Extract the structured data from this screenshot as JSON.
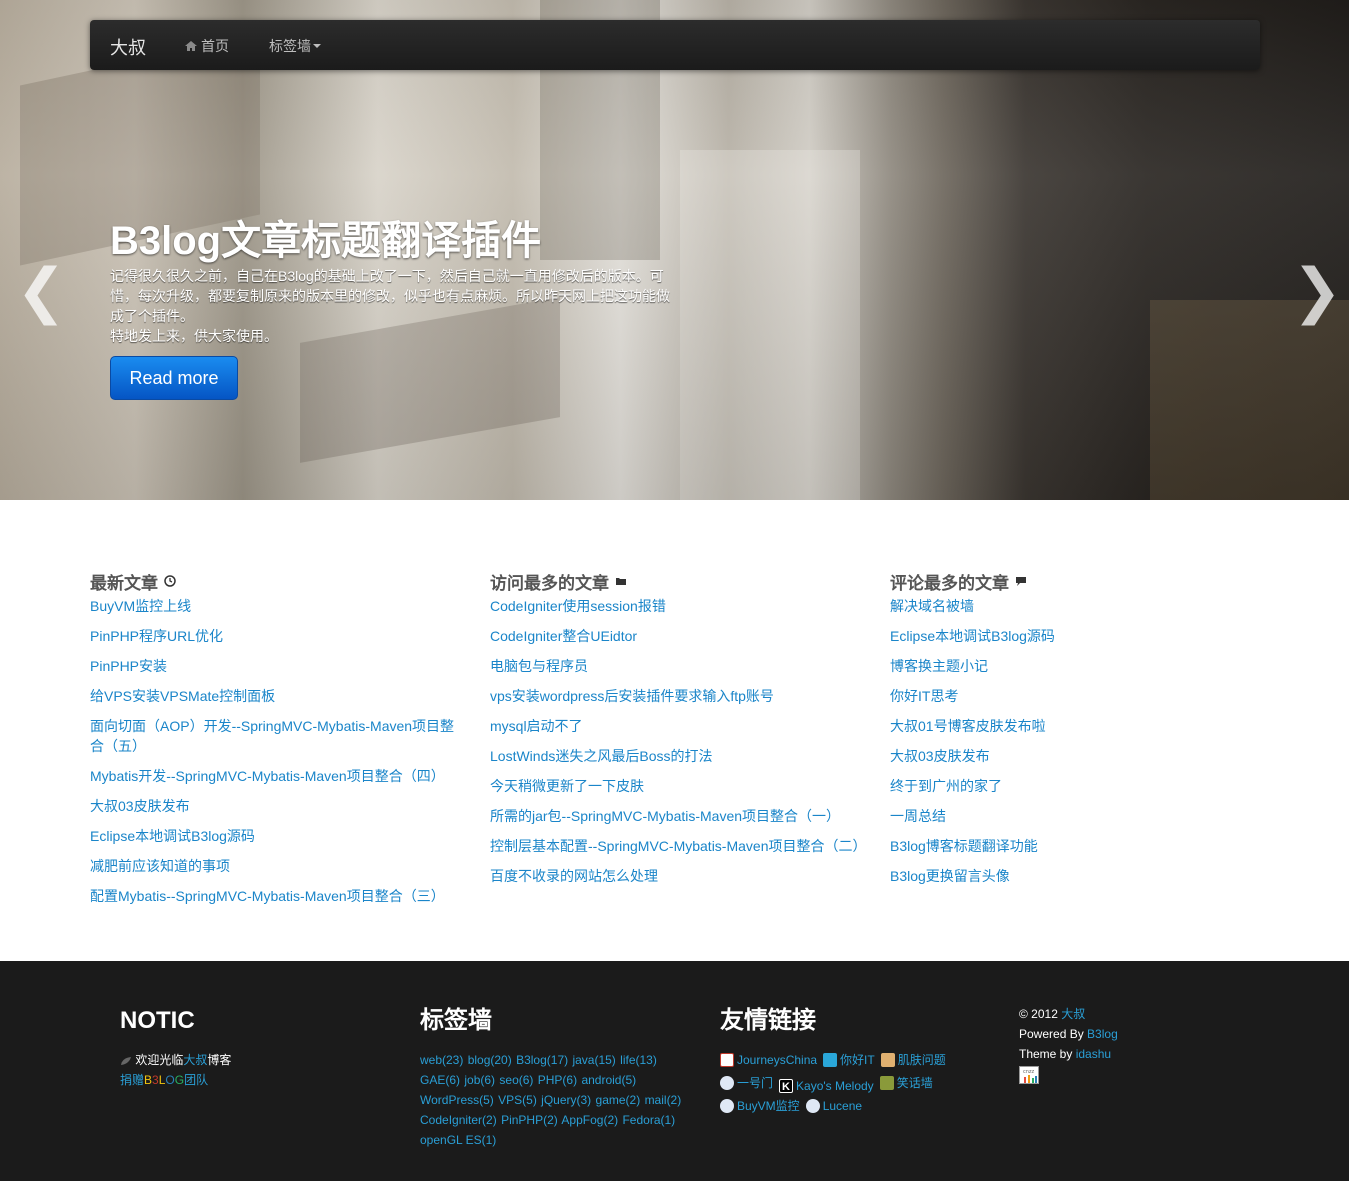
{
  "nav": {
    "brand": "大叔",
    "home": "首页",
    "tags": "标签墙"
  },
  "hero": {
    "title": "B3log文章标题翻译插件",
    "paragraph1": "记得很久很久之前，自己在B3log的基础上改了一下，然后自己就一直用修改后的版本。可惜，每次升级，都要复制原来的版本里的修改，似乎也有点麻烦。所以昨天网上把这功能做成了个插件。",
    "paragraph2": "特地发上来，供大家使用。",
    "button": "Read more",
    "prev": "❮",
    "next": "❯"
  },
  "columns": {
    "latest": {
      "title": "最新文章",
      "items": [
        "BuyVM监控上线",
        "PinPHP程序URL优化",
        "PinPHP安装",
        "给VPS安装VPSMate控制面板",
        "面向切面（AOP）开发--SpringMVC-Mybatis-Maven项目整合（五）",
        "Mybatis开发--SpringMVC-Mybatis-Maven项目整合（四）",
        "大叔03皮肤发布",
        "Eclipse本地调试B3log源码",
        "减肥前应该知道的事项",
        "配置Mybatis--SpringMVC-Mybatis-Maven项目整合（三）"
      ]
    },
    "most_viewed": {
      "title": "访问最多的文章",
      "items": [
        "CodeIgniter使用session报错",
        "CodeIgniter整合UEidtor",
        "电脑包与程序员",
        "vps安装wordpress后安装插件要求输入ftp账号",
        "mysql启动不了",
        "LostWinds迷失之风最后Boss的打法",
        "今天稍微更新了一下皮肤",
        "所需的jar包--SpringMVC-Mybatis-Maven项目整合（一）",
        "控制层基本配置--SpringMVC-Mybatis-Maven项目整合（二）",
        "百度不收录的网站怎么处理"
      ]
    },
    "most_commented": {
      "title": "评论最多的文章",
      "items": [
        "解决域名被墙",
        "Eclipse本地调试B3log源码",
        "博客换主题小记",
        "你好IT思考",
        "大叔01号博客皮肤发布啦",
        "大叔03皮肤发布",
        "终于到广州的家了",
        "一周总结",
        "B3log博客标题翻译功能",
        "B3log更换留言头像"
      ]
    }
  },
  "footer": {
    "notic": {
      "title": "NOTIC",
      "welcome": "欢迎光临",
      "owner": "大叔",
      "blog": "博客",
      "thanks_prefix": "捐赠",
      "b3log_letters": [
        "B",
        "3",
        "L",
        "O",
        "G"
      ],
      "thanks_suffix": "团队"
    },
    "tags": {
      "title": "标签墙",
      "items": [
        "web(23)",
        "blog(20)",
        "B3log(17)",
        "java(15)",
        "life(13)",
        "GAE(6)",
        "job(6)",
        "seo(6)",
        "PHP(6)",
        "android(5)",
        "WordPress(5)",
        "VPS(5)",
        "jQuery(3)",
        "game(2)",
        "mail(2)",
        "CodeIgniter(2)",
        "PinPHP(2)",
        "AppFog(2)",
        "Fedora(1)",
        "openGL ES(1)"
      ]
    },
    "links": {
      "title": "友情链接",
      "items": [
        {
          "label": "JourneysChina",
          "icon": "journeyschina-icon",
          "color": "#c0392b"
        },
        {
          "label": "你好IT",
          "icon": "nihaoit-icon",
          "color": "#2aa6d8"
        },
        {
          "label": "肌肤问题",
          "icon": "skin-icon",
          "color": "#e0b070"
        },
        {
          "label": "一号门",
          "icon": "globe-icon",
          "color": "#4a7fc0"
        },
        {
          "label": "Kayo's Melody",
          "icon": "k-icon",
          "color": "#000000"
        },
        {
          "label": "笑话墙",
          "icon": "joke-icon",
          "color": "#8a9a3a"
        },
        {
          "label": "BuyVM监控",
          "icon": "globe-icon",
          "color": "#4a7fc0"
        },
        {
          "label": "Lucene",
          "icon": "globe-icon",
          "color": "#4a7fc0"
        }
      ]
    },
    "copyright": {
      "year": "© 2012",
      "owner": "大叔",
      "powered_label": "Powered By",
      "powered": "B3log",
      "theme_label": "Theme by",
      "theme": "idashu",
      "counter": "cnzz"
    }
  }
}
